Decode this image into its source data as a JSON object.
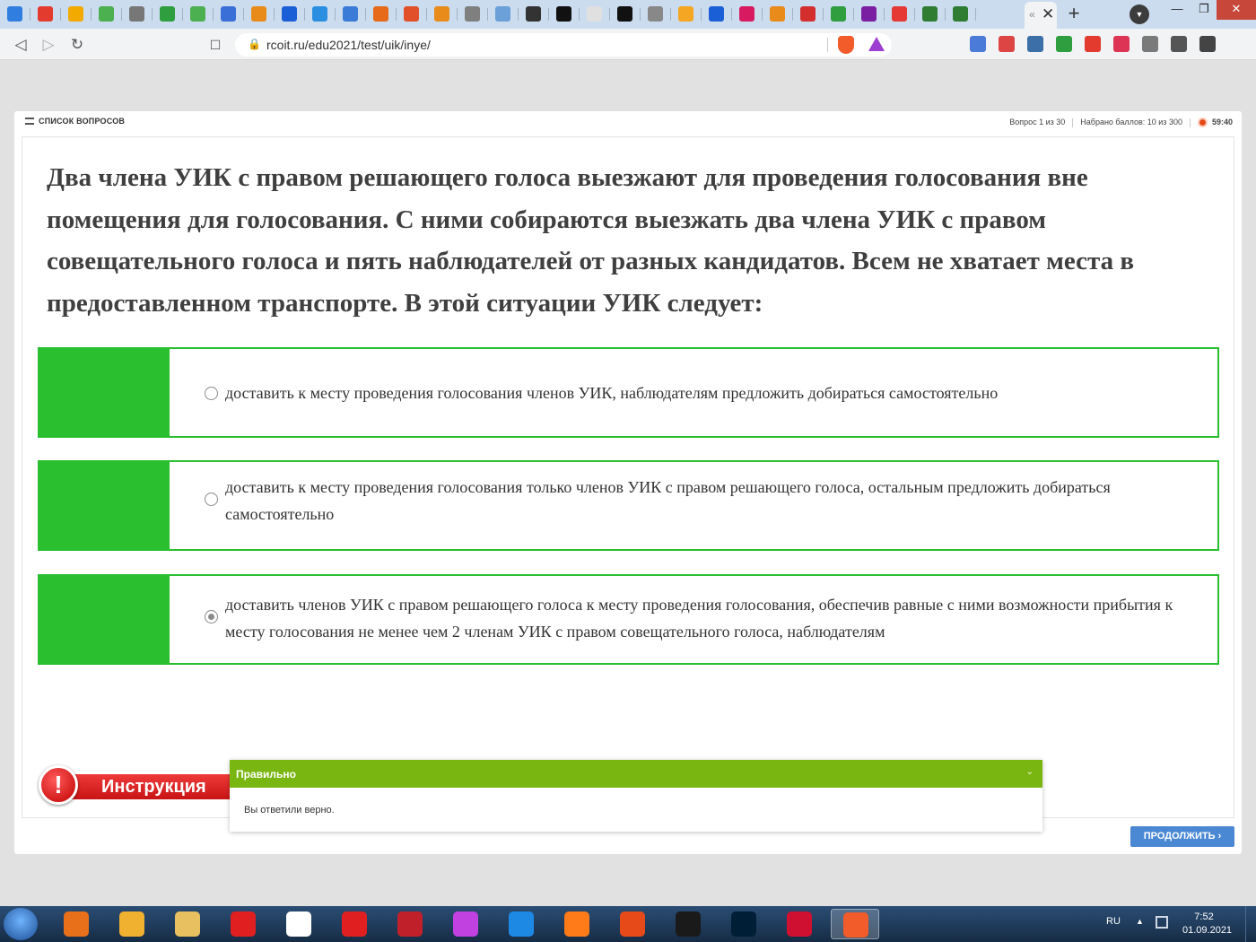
{
  "browser": {
    "active_tab_close": "✕",
    "new_tab": "+",
    "window_controls": {
      "minimize": "—",
      "maximize": "❐",
      "close": "✕"
    },
    "url": "rcoit.ru/edu2021/test/uik/inye/",
    "favicon_colors": [
      "#2f7ee0",
      "#e33b2e",
      "#f2a900",
      "#4caf50",
      "#777777",
      "#2e9e3e",
      "#4caf50",
      "#3a6fd8",
      "#e98b1a",
      "#1b5fd6",
      "#2a8fe0",
      "#3b7bd8",
      "#e66a1a",
      "#e2502a",
      "#e98b1a",
      "#7f7f7f",
      "#6ba0d8",
      "#333333",
      "#111111",
      "#e0e0e0",
      "#111111",
      "#888888",
      "#f5a623",
      "#1b5fd6",
      "#d81b60",
      "#e98b1a",
      "#d32f2f",
      "#2e9e3e",
      "#7b1fa2",
      "#e53935",
      "#2e7d32",
      "#2e7d32"
    ],
    "extension_colors": [
      "#4a7bd8",
      "#d44",
      "#3c6ea8",
      "#2e9e3e",
      "#e33b2e",
      "#d35",
      "#7a7a7a",
      "#555555",
      "#444444"
    ]
  },
  "quiz": {
    "question_list_label": "СПИСОК ВОПРОСОВ",
    "question_counter": "Вопрос 1 из 30",
    "score": "Набрано баллов: 10 из 300",
    "timer": "59:40",
    "question": "Два члена УИК с правом решающего голоса выезжают для проведения голосования вне помещения для голосования. С ними собираются выезжать два члена УИК с правом совещательного голоса и пять наблюдателей от разных кандидатов. Всем не хватает места в предоставленном транспорте. В этой ситуации УИК следует:",
    "answers": [
      {
        "text": "доставить к месту проведения голосования членов УИК, наблюдателям предложить добираться самостоятельно",
        "selected": false
      },
      {
        "text": "доставить к месту проведения голосования только членов УИК с правом решающего голоса, остальным предложить добираться самостоятельно",
        "selected": false
      },
      {
        "text": "доставить членов УИК с правом решающего голоса к месту проведения голосования, обеспечив равные с ними возможности прибытия к месту голосования не менее чем 2 членам УИК с правом совещательного голоса, наблюдателям",
        "selected": true
      }
    ],
    "feedback_title": "Правильно",
    "feedback_text": "Вы ответили верно.",
    "instruction_label": "Инструкция",
    "continue_label": "ПРОДОЛЖИТЬ ›",
    "accent_color": "#29bf2f",
    "feedback_color": "#7ab611",
    "button_color": "#4a88d3"
  },
  "taskbar": {
    "app_colors": [
      "#e8701a",
      "#f0b030",
      "#e8c060",
      "#e02020",
      "#ffffff",
      "#e02020",
      "#c0202a",
      "#c040e0",
      "#1e88e5",
      "#ff7a18",
      "#e64a19",
      "#1a1a1a",
      "#001e36",
      "#d01030",
      "#f25b2a"
    ],
    "language": "RU",
    "tray_expand": "▲",
    "time": "7:52",
    "date": "01.09.2021"
  }
}
